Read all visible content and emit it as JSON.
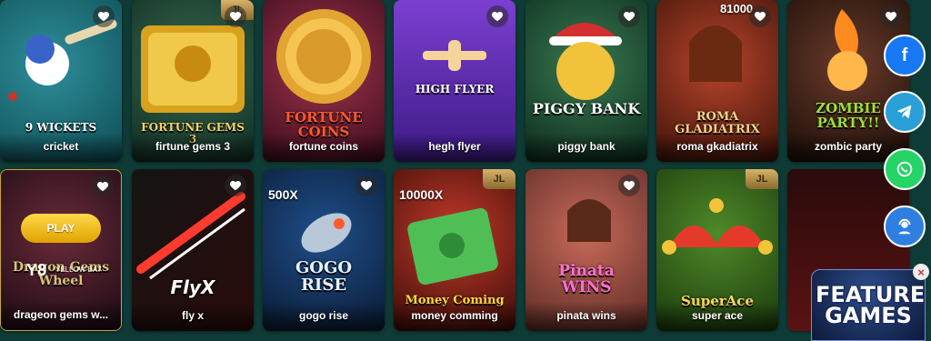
{
  "games_row1": [
    {
      "label": "cricket",
      "art_title": "9 WICKETS",
      "has_heart": true,
      "badge": ""
    },
    {
      "label": "firtune gems 3",
      "art_title": "FORTUNE GEMS 3",
      "has_heart": true,
      "badge": "JL"
    },
    {
      "label": "fortune coins",
      "art_title": "FORTUNE\nCOINS",
      "has_heart": false,
      "badge": ""
    },
    {
      "label": "hegh flyer",
      "art_title": "HIGH FLYER",
      "has_heart": true,
      "badge": ""
    },
    {
      "label": "piggy bank",
      "art_title": "PIGGY BANK",
      "has_heart": true,
      "badge": ""
    },
    {
      "label": "roma gkadiatrix",
      "art_title": "ROMA\nGLADIATRIX",
      "has_heart": true,
      "badge": "",
      "counter": "81000"
    },
    {
      "label": "zombic party",
      "art_title": "ZOMBIE\nPARTY!!",
      "has_heart": true,
      "badge": ""
    }
  ],
  "games_row2": [
    {
      "label": "drageon gems w...",
      "art_title": "Dragon Gems\nWheel",
      "has_heart": true,
      "badge": "",
      "play_label": "PLAY",
      "provider": "YELLOW BAT"
    },
    {
      "label": "fly x",
      "art_title": "FlyX",
      "has_heart": true,
      "badge": ""
    },
    {
      "label": "gogo rise",
      "art_title": "GOGO\nRISE",
      "has_heart": true,
      "badge": "",
      "mult": "500X"
    },
    {
      "label": "money comming",
      "art_title": "Money Coming",
      "has_heart": false,
      "badge": "JL",
      "mult": "10000X"
    },
    {
      "label": "pinata wins",
      "art_title": "Pinata\nWINS",
      "has_heart": true,
      "badge": ""
    },
    {
      "label": "super ace",
      "art_title": "SuperAce",
      "has_heart": false,
      "badge": "JL"
    },
    {
      "label": "",
      "art_title": "",
      "has_heart": false,
      "badge": ""
    }
  ],
  "social": {
    "facebook_glyph": "f",
    "colors": {
      "facebook": "#1877f2",
      "telegram": "#2a9fd8",
      "whatsapp": "#25d366",
      "support": "#2f7fe0"
    }
  },
  "featured": {
    "text": "FEATURED GAMES",
    "close": "×"
  },
  "theme": {
    "background": "#0f3b36",
    "heart": "#ffffff"
  }
}
